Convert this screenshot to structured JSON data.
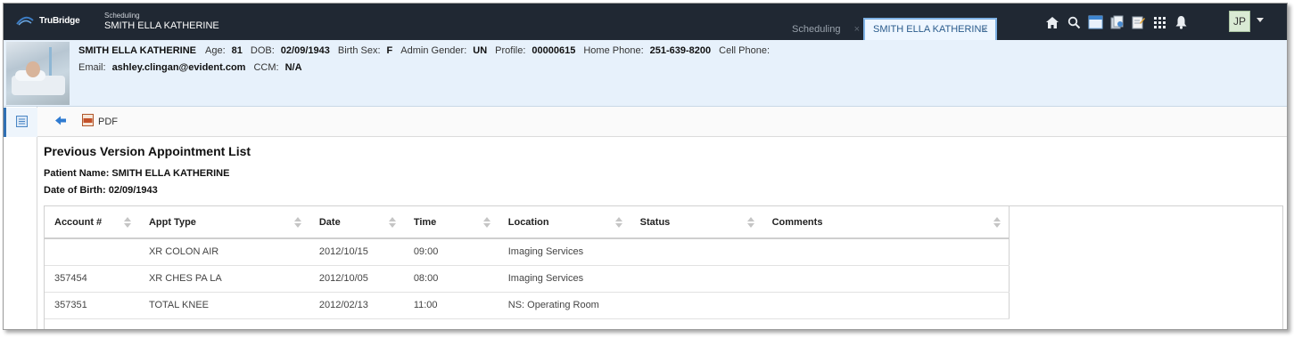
{
  "brand": {
    "name": "TruBridge"
  },
  "app": {
    "module": "Scheduling",
    "patient": "SMITH ELLA KATHERINE"
  },
  "tabs": [
    {
      "label": "Scheduling",
      "close": "×"
    },
    {
      "label": "SMITH ELLA KATHERINE",
      "close": "×"
    }
  ],
  "user": {
    "initials": "JP"
  },
  "banner": {
    "name": "SMITH ELLA KATHERINE",
    "fields": {
      "age_label": "Age:",
      "age": "81",
      "dob_label": "DOB:",
      "dob": "02/09/1943",
      "sex_label": "Birth Sex:",
      "sex": "F",
      "gender_label": "Admin Gender:",
      "gender": "UN",
      "profile_label": "Profile:",
      "profile": "00000615",
      "home_label": "Home Phone:",
      "home": "251-639-8200",
      "cell_label": "Cell Phone:",
      "email_label": "Email:",
      "email": "ashley.clingan@evident.com",
      "ccm_label": "CCM:",
      "ccm": "N/A"
    }
  },
  "toolbar": {
    "pdf_label": "PDF"
  },
  "page": {
    "title": "Previous Version Appointment List",
    "patient_name": "Patient Name: SMITH ELLA KATHERINE",
    "dob": "Date of Birth: 02/09/1943"
  },
  "grid": {
    "columns": [
      "Account #",
      "Appt Type",
      "Date",
      "Time",
      "Location",
      "Status",
      "Comments"
    ],
    "rows": [
      [
        "",
        "XR COLON AIR",
        "2012/10/15",
        "09:00",
        "Imaging Services",
        "",
        ""
      ],
      [
        "357454",
        "XR CHES PA LA",
        "2012/10/05",
        "08:00",
        "Imaging Services",
        "",
        ""
      ],
      [
        "357351",
        "TOTAL KNEE",
        "2012/02/13",
        "11:00",
        "NS: Operating Room",
        "",
        ""
      ]
    ]
  },
  "colors": {
    "topbar": "#202833",
    "banner": "#e7f1fb",
    "accent": "#2f6fb3"
  }
}
